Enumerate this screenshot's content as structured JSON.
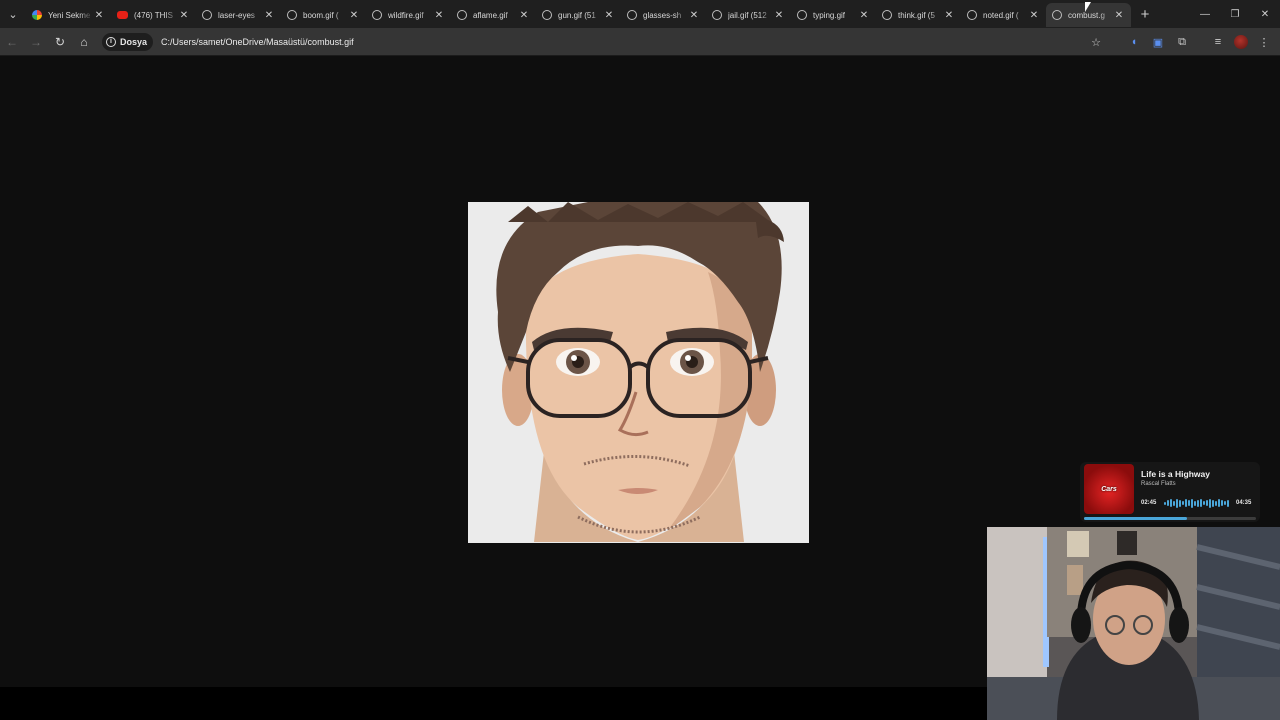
{
  "tabs": [
    {
      "title": "Yeni Sekme",
      "icon": "google-icon",
      "active": false
    },
    {
      "title": "(476) THIS",
      "icon": "youtube-icon",
      "active": false
    },
    {
      "title": "laser-eyes",
      "icon": "globe-icon",
      "active": false
    },
    {
      "title": "boom.gif (",
      "icon": "globe-icon",
      "active": false
    },
    {
      "title": "wildfire.gif",
      "icon": "globe-icon",
      "active": false
    },
    {
      "title": "aflame.gif",
      "icon": "globe-icon",
      "active": false
    },
    {
      "title": "gun.gif (51",
      "icon": "globe-icon",
      "active": false
    },
    {
      "title": "glasses-sh",
      "icon": "globe-icon",
      "active": false
    },
    {
      "title": "jail.gif (512",
      "icon": "globe-icon",
      "active": false
    },
    {
      "title": "typing.gif",
      "icon": "globe-icon",
      "active": false
    },
    {
      "title": "think.gif (5",
      "icon": "globe-icon",
      "active": false
    },
    {
      "title": "noted.gif (",
      "icon": "globe-icon",
      "active": false
    },
    {
      "title": "combust.g",
      "icon": "globe-icon",
      "active": true
    }
  ],
  "toolbar": {
    "chip_label": "Dosya",
    "url": "C:/Users/samet/OneDrive/Masaüstü/combust.gif"
  },
  "media_player": {
    "song": "Life is a Highway",
    "artist": "Rascal Flatts",
    "elapsed": "02:45",
    "duration": "04:35",
    "progress": 0.6,
    "art_text": "Cars"
  },
  "colors": {
    "accent": "#4aa6d9",
    "background": "#0e0e0e",
    "tabbar": "#1f1f1f",
    "toolbar": "#353535"
  }
}
